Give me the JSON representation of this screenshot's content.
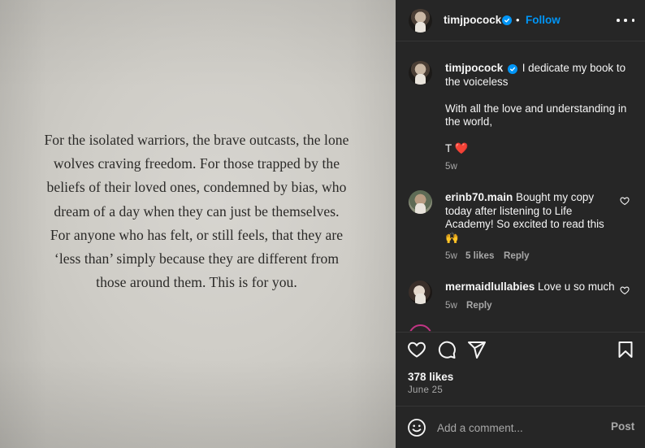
{
  "post": {
    "image_text_lines": [
      "For the isolated warriors, the brave outcasts, the lone",
      "wolves craving freedom. For those trapped by the",
      "beliefs of their loved ones, condemned by bias, who",
      "dream of a day when they can just be themselves.",
      "For anyone who has felt, or still feels, that they are",
      "‘less than’ simply because they are different from",
      "those around them. This is for you."
    ]
  },
  "header": {
    "username": "timjpocock",
    "separator": "•",
    "follow_label": "Follow"
  },
  "caption": {
    "username": "timjpocock",
    "line1": "I dedicate my book to the voiceless",
    "line2": "With all the love and understanding in the world,",
    "line3": "T ❤️",
    "time": "5w"
  },
  "comments": [
    {
      "username": "erinb70.main",
      "text": "Bought my copy today after listening to Life Academy! So excited to read this 🙌",
      "time": "5w",
      "likes": "5 likes",
      "reply_label": "Reply"
    },
    {
      "username": "mermaidlullabies",
      "text": "Love u so much",
      "time": "5w",
      "reply_label": "Reply"
    }
  ],
  "footer": {
    "likes": "378 likes",
    "date": "June 25",
    "comment_placeholder": "Add a comment...",
    "post_label": "Post"
  },
  "icons": {
    "verified": "verified-badge-icon",
    "more": "more-options-icon",
    "like": "heart-icon",
    "comment": "comment-icon",
    "share": "share-icon",
    "save": "bookmark-icon",
    "emoji": "emoji-icon"
  },
  "colors": {
    "panel_bg": "#262626",
    "accent": "#0095f6",
    "secondary_text": "#a8a8a8",
    "heart": "#ed4956"
  }
}
